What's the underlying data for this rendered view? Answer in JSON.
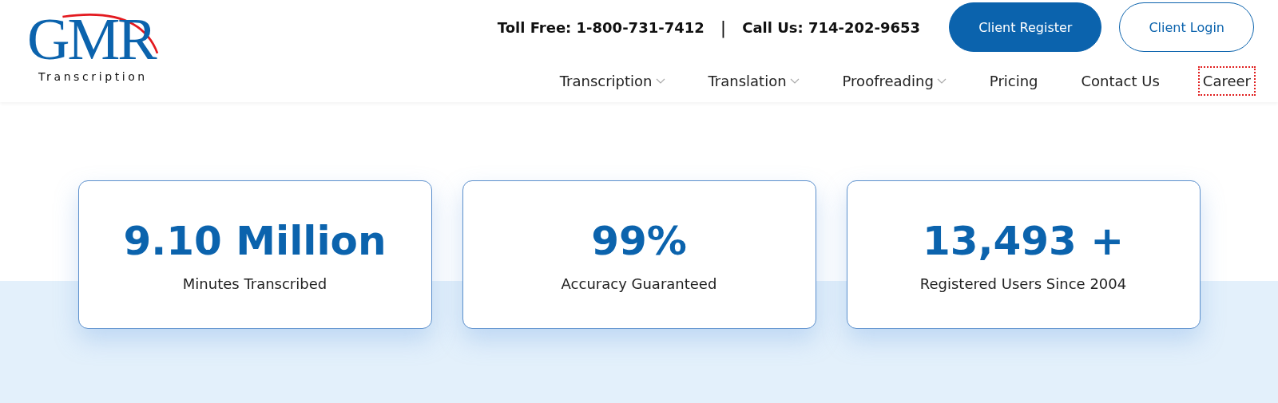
{
  "logo": {
    "wordmark": "GMR",
    "tagline": "Transcription"
  },
  "contact": {
    "toll_free": "Toll Free: 1-800-731-7412",
    "separator": "|",
    "call_us": "Call Us: 714-202-9653"
  },
  "buttons": [
    {
      "label": "Client Register",
      "kind": "filled"
    },
    {
      "label": "Client Login",
      "kind": "outline"
    }
  ],
  "nav": [
    {
      "label": "Transcription",
      "dropdown": true,
      "focused": false
    },
    {
      "label": "Translation",
      "dropdown": true,
      "focused": false
    },
    {
      "label": "Proofreading",
      "dropdown": true,
      "focused": false
    },
    {
      "label": "Pricing",
      "dropdown": false,
      "focused": false
    },
    {
      "label": "Contact Us",
      "dropdown": false,
      "focused": false
    },
    {
      "label": "Career",
      "dropdown": false,
      "focused": true
    }
  ],
  "stats": [
    {
      "value": "9.10 Million",
      "label": "Minutes Transcribed"
    },
    {
      "value": "99%",
      "label": "Accuracy Guaranteed"
    },
    {
      "value": "13,493 +",
      "label": "Registered Users Since 2004"
    }
  ]
}
